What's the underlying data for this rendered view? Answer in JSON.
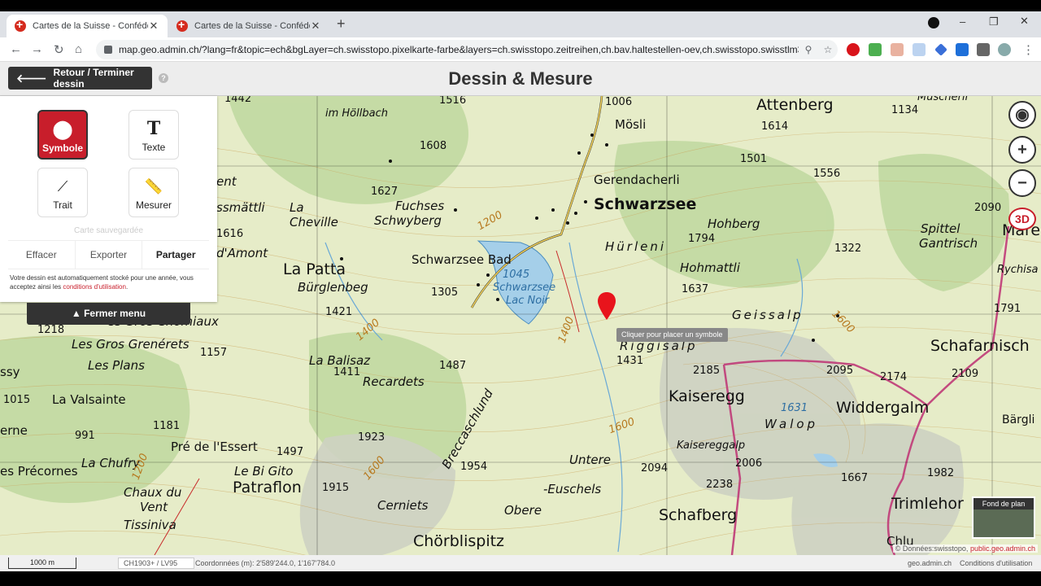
{
  "browser": {
    "tabs": [
      {
        "title": "Cartes de la Suisse - Confédératio"
      },
      {
        "title": "Cartes de la Suisse - Confédératio"
      }
    ],
    "url": "map.geo.admin.ch/?lang=fr&topic=ech&bgLayer=ch.swisstopo.pixelkarte-farbe&layers=ch.swisstopo.zeitreihen,ch.bav.haltestellen-oev,ch.swisstopo.swisstlm3..."
  },
  "header": {
    "back_label": "Retour / Terminer dessin",
    "title": "Dessin & Mesure"
  },
  "panel": {
    "tools": [
      {
        "label": "Symbole"
      },
      {
        "label": "Texte"
      },
      {
        "label": "Trait"
      },
      {
        "label": "Mesurer"
      }
    ],
    "saved_status": "Carte sauvegardée",
    "actions": [
      "Effacer",
      "Exporter",
      "Partager"
    ],
    "notice_text": "Votre dessin est automatiquement stocké pour une année, vous acceptez ainsi les ",
    "notice_link": "conditions d'utilisation",
    "notice_end": ".",
    "close_menu": "Fermer menu"
  },
  "map": {
    "tooltip": "Cliquer pour placer un symbole",
    "btn_3d": "3D",
    "bg_thumb_label": "Fond de plan",
    "labels": {
      "attenberg": "Attenberg",
      "moesli": "Mösli",
      "gerendacherli": "Gerendacherli",
      "schwarzsee": "Schwarzsee",
      "fuchses": "Fuchses",
      "schwyberg": "Schwyberg",
      "la_cheville": "La",
      "la_cheville2": "Cheville",
      "la_patta": "La Patta",
      "burglenbeg": "Bürglenbeg",
      "schwarzsee_bad": "Schwarzsee Bad",
      "hurleni": "Hürleni",
      "hohberg": "Hohberg",
      "hohmattli": "Hohmattli",
      "geissalp": "Geissalp",
      "riggisalp": "Riggisalp",
      "kaiseregg": "Kaiseregg",
      "widdergalm": "Widdergalm",
      "walop": "Walop",
      "kaisereggalp": "Kaisereggalp",
      "schafberg": "Schafberg",
      "trimlehorn": "Trimlehor",
      "schafarnisch": "Schafarnisch",
      "spittel": "Spittel",
      "gantrisch": "Gantrisch",
      "rychisa": "Rychisa",
      "mare": "Mare",
      "chorblispitz": "Chörblispitz",
      "euschels": "-Euschels",
      "untere": "Untere",
      "obere": "Obere",
      "cerniets": "Cerniets",
      "patraflon": "Patraflon",
      "le_bi_gito": "Le Bi Gito",
      "pre_lessert": "Pré de l'Essert",
      "la_chufry": "La Chufry",
      "chaux_du": "Chaux du",
      "vent": "Vent",
      "tissiniva": "Tissiniva",
      "les_precornes": "es Précornes",
      "la_valsainte": "La Valsainte",
      "les_plans": "Les Plans",
      "gros_grenerets": "Les Gros Grenérets",
      "gros_chomiaux": "es Gros Chomiaux",
      "la_balisaz": "La Balisaz",
      "recardets": "Recardets",
      "breccaschlund": "Breccaschlund",
      "im_hollbach": "im Höllbach",
      "lamont": "d'Amont",
      "mattli": "ssmättli",
      "ent": "ent",
      "lac_schwarzsee": "Schwarzsee",
      "lac_noir": "Lac Noir",
      "lake_1045": "1045",
      "lake_1631": "1631",
      "chlu": "Chlu",
      "barglis": "Bärgli",
      "ssy": "ssy",
      "erne": "erne",
      "muscherli": "Muscherli"
    },
    "spot_heights": [
      "1442",
      "1516",
      "1006",
      "1134",
      "1614",
      "1608",
      "1501",
      "1556",
      "1627",
      "1200",
      "2090",
      "1794",
      "1322",
      "1616",
      "1305",
      "1421",
      "1637",
      "1791",
      "1218",
      "1157",
      "1487",
      "1431",
      "2185",
      "2095",
      "2174",
      "2109",
      "1015",
      "1411",
      "991",
      "1181",
      "1923",
      "1497",
      "1954",
      "2094",
      "2006",
      "1915",
      "2238",
      "1667",
      "1982",
      "1400",
      "1600",
      "1600",
      "1600",
      "1400",
      "1200"
    ]
  },
  "footer": {
    "scale": "1000 m",
    "projection": "CH1903+ / LV95",
    "coordinates": "Coordonnées (m): 2'589'244.0, 1'167'784.0",
    "geo_link": "geo.admin.ch",
    "terms": "Conditions d'utilisation",
    "attribution_text": "© Données:swisstopo, ",
    "attribution_link": "public.geo.admin.ch"
  }
}
